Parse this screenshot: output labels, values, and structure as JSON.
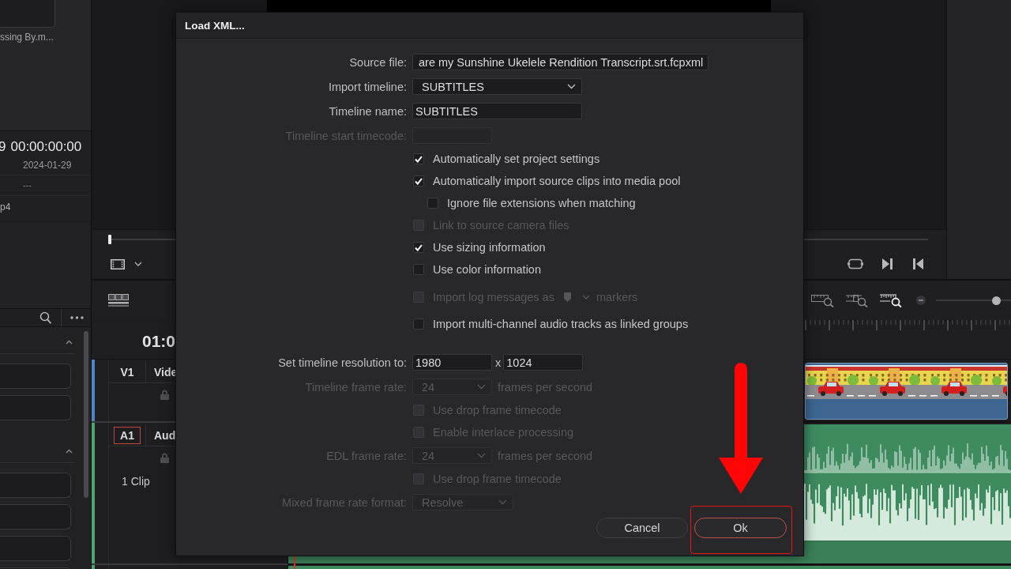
{
  "media_pool": {
    "clip_name": "ssing By.m...",
    "metadata": {
      "timecode_cut": "9",
      "timecode": "00:00:00:00",
      "date": "2024-01-29",
      "row_3": "---",
      "row_4": "p4"
    },
    "sections": [
      {
        "expanded": true
      },
      {
        "expanded": true
      }
    ]
  },
  "viewer": {
    "scrubber": {
      "level": 0
    }
  },
  "timeline": {
    "timecode": "01:0",
    "zoom_slider": {
      "level": 0.84
    },
    "tracks": [
      {
        "kind": "video",
        "label": "V1",
        "name": "Vide",
        "selected": false,
        "color": "#4f86c2"
      },
      {
        "kind": "audio",
        "label": "A1",
        "name": "Aud",
        "selected": true,
        "color": "#4aa56e",
        "info": "1 Clip"
      }
    ]
  },
  "dialog": {
    "title": "Load XML...",
    "sections": [
      {
        "rows": [
          {
            "kind": "path_field",
            "label": "Source file:",
            "value": "are my Sunshine Ukelele Rendition Transcript.srt.fcpxml",
            "disabled": false
          },
          {
            "kind": "dropdown",
            "label": "Import timeline:",
            "value": "SUBTITLES",
            "disabled": false
          },
          {
            "kind": "text_field",
            "label": "Timeline name:",
            "value": "SUBTITLES",
            "disabled": false
          },
          {
            "kind": "timecode_field",
            "label": "Timeline start timecode:",
            "disabled": true
          },
          {
            "kind": "checkbox",
            "label": "Automatically set project settings",
            "checked": true,
            "disabled": false
          },
          {
            "kind": "checkbox",
            "label": "Automatically import source clips into media pool",
            "checked": true,
            "disabled": false,
            "children": [
              {
                "kind": "checkbox",
                "label": "Ignore file extensions when matching",
                "checked": false,
                "disabled": false
              }
            ]
          },
          {
            "kind": "checkbox",
            "label": "Link to source camera files",
            "checked": false,
            "disabled": true
          },
          {
            "kind": "checkbox",
            "label": "Use sizing information",
            "checked": true,
            "disabled": false
          },
          {
            "kind": "checkbox",
            "label": "Use color information",
            "checked": false,
            "disabled": false
          },
          {
            "kind": "checkbox_marker",
            "label": "Import log messages as",
            "suffix": "markers",
            "checked": false,
            "disabled": true
          },
          {
            "kind": "checkbox",
            "label": "Import multi-channel audio tracks as linked groups",
            "checked": false,
            "disabled": false
          }
        ]
      },
      {
        "rows": [
          {
            "kind": "size_fields",
            "label": "Set timeline resolution to:",
            "values": [
              "1980",
              "1024"
            ],
            "separator": "x",
            "disabled": false
          },
          {
            "kind": "rate_dropdown",
            "label": "Timeline frame rate:",
            "value": "24",
            "unit": "frames per second",
            "disabled": true
          },
          {
            "kind": "checkbox",
            "label": "Use drop frame timecode",
            "checked": false,
            "disabled": true
          },
          {
            "kind": "checkbox",
            "label": "Enable interlace processing",
            "checked": false,
            "disabled": true
          },
          {
            "kind": "rate_dropdown",
            "label": "EDL frame rate:",
            "value": "24",
            "unit": "frames per second",
            "disabled": true
          },
          {
            "kind": "checkbox",
            "label": "Use drop frame timecode",
            "checked": false,
            "disabled": true
          },
          {
            "kind": "format_dropdown",
            "label": "Mixed frame rate format:",
            "value": "Resolve",
            "disabled": true
          }
        ]
      }
    ],
    "buttons": [
      {
        "label": "Cancel",
        "kind": "secondary"
      },
      {
        "label": "Ok",
        "kind": "primary"
      }
    ]
  }
}
